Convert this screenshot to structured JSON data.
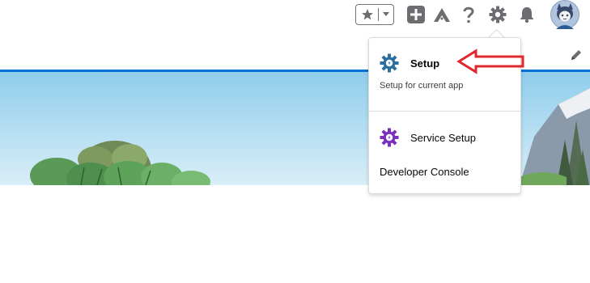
{
  "header": {
    "favorites_icon": "star-icon",
    "favorites_menu_icon": "chevron-down-icon",
    "global_actions_icon": "plus-icon",
    "trailhead_icon": "trailhead-icon",
    "help_icon": "help-icon",
    "setup_icon": "gear-icon",
    "notifications_icon": "bell-icon",
    "avatar_icon": "avatar-icon"
  },
  "setup_menu": {
    "setup_label": "Setup",
    "setup_sublabel": "Setup for current app",
    "service_setup_label": "Service Setup",
    "developer_console_label": "Developer Console"
  },
  "colors": {
    "accent_blue": "#0070d2",
    "setup_gear": "#2e6e9e",
    "service_gear": "#7b2fbe",
    "annotation_arrow": "#e0282d"
  }
}
